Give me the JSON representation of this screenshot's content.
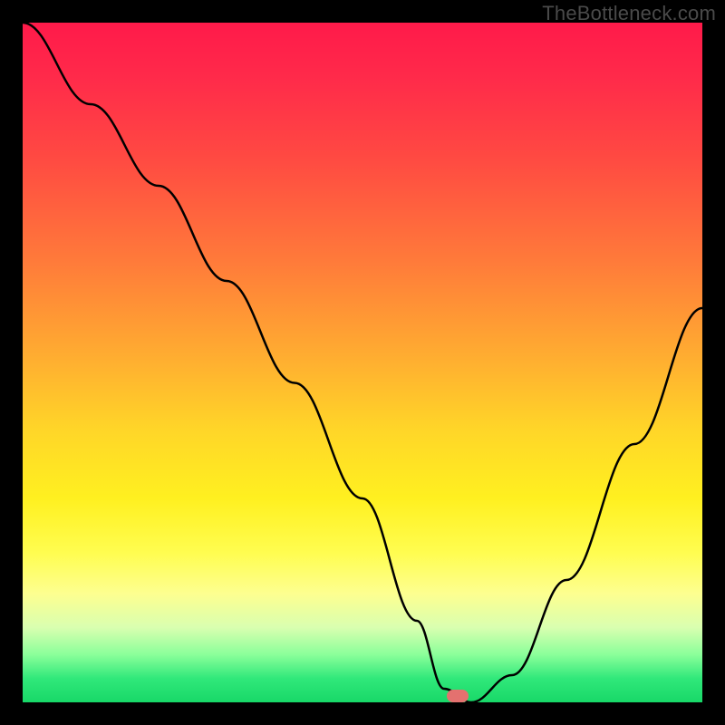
{
  "watermark": "TheBottleneck.com",
  "chart_data": {
    "type": "line",
    "title": "",
    "xlabel": "",
    "ylabel": "",
    "xlim": [
      0,
      100
    ],
    "ylim": [
      0,
      100
    ],
    "x": [
      0,
      10,
      20,
      30,
      40,
      50,
      58,
      62,
      66,
      72,
      80,
      90,
      100
    ],
    "values": [
      100,
      88,
      76,
      62,
      47,
      30,
      12,
      2,
      0,
      4,
      18,
      38,
      58
    ],
    "marker": {
      "x": 64,
      "y": 1
    },
    "background_gradient": {
      "direction": "vertical",
      "stops": [
        {
          "pos": 0,
          "color": "#ff1a4a"
        },
        {
          "pos": 0.35,
          "color": "#ff7a3a"
        },
        {
          "pos": 0.6,
          "color": "#ffd628"
        },
        {
          "pos": 0.78,
          "color": "#fffd50"
        },
        {
          "pos": 0.93,
          "color": "#8aff9a"
        },
        {
          "pos": 1.0,
          "color": "#18d868"
        }
      ]
    }
  }
}
